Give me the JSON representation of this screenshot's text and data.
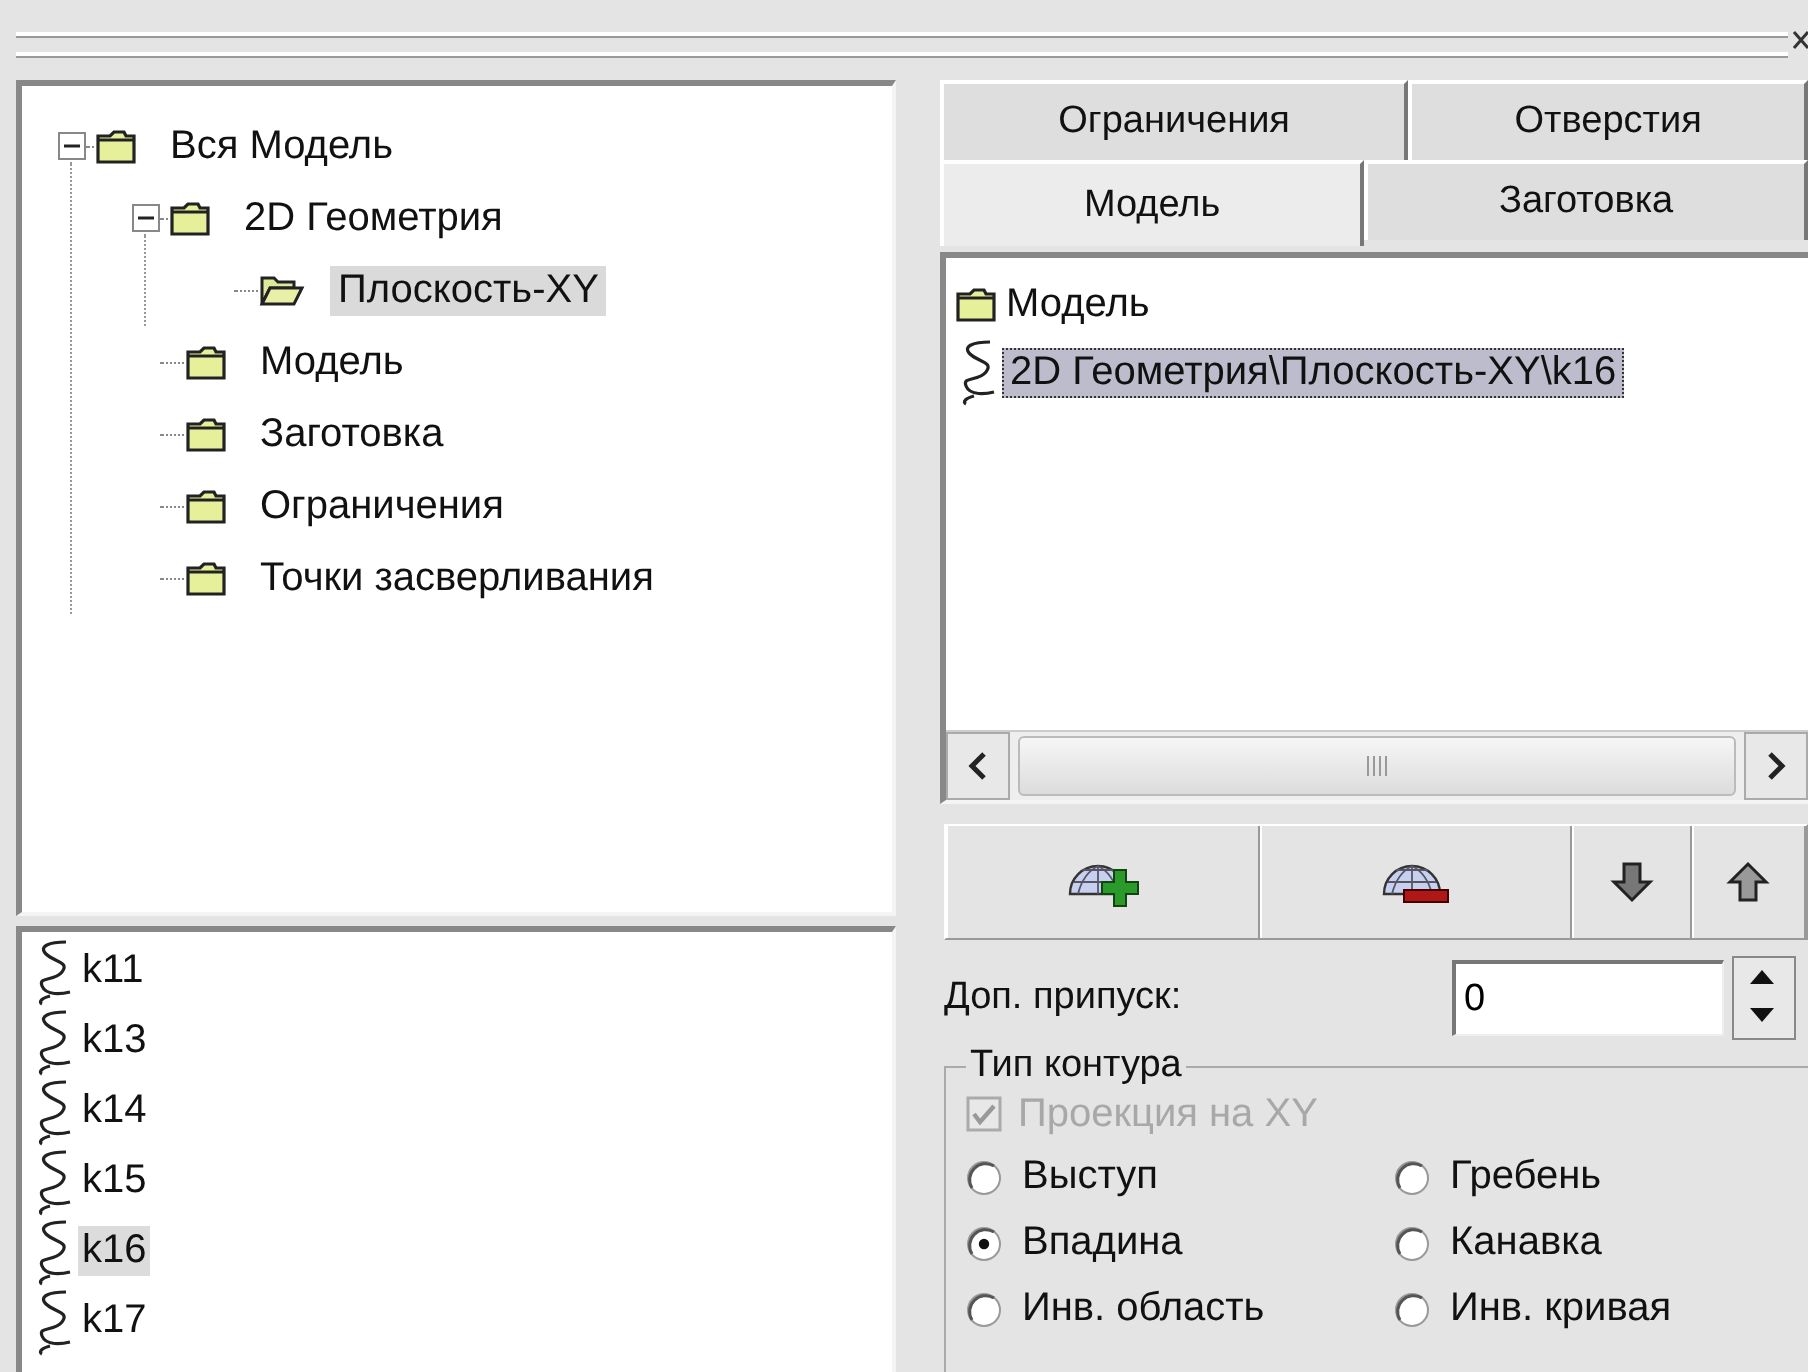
{
  "tree": [
    {
      "label": "Вся Модель",
      "kind": "folder",
      "selected": false,
      "expanded": true,
      "children": [
        {
          "label": "2D Геометрия",
          "kind": "folder",
          "selected": false,
          "expanded": true,
          "children": [
            {
              "label": "Плоскость-XY",
              "kind": "plane",
              "selected": true
            }
          ]
        },
        {
          "label": "Модель",
          "kind": "folder",
          "selected": false
        },
        {
          "label": "Заготовка",
          "kind": "folder",
          "selected": false
        },
        {
          "label": "Ограничения",
          "kind": "folder",
          "selected": false
        },
        {
          "label": "Точки засверливания",
          "kind": "folder",
          "selected": false
        }
      ]
    }
  ],
  "contours": [
    {
      "label": "k11",
      "selected": false
    },
    {
      "label": "k13",
      "selected": false
    },
    {
      "label": "k14",
      "selected": false
    },
    {
      "label": "k15",
      "selected": false
    },
    {
      "label": "k16",
      "selected": true
    },
    {
      "label": "k17",
      "selected": false
    }
  ],
  "tab_rows": [
    {
      "tabs": [
        {
          "label": "Ограничения",
          "selected": false
        },
        {
          "label": "Отверстия",
          "selected": false
        }
      ]
    },
    {
      "tabs": [
        {
          "label": "Модель",
          "selected": true
        },
        {
          "label": "Заготовка",
          "selected": false
        }
      ]
    }
  ],
  "model_list": [
    {
      "label": "Модель",
      "kind": "folder",
      "selected": false
    },
    {
      "label": "2D Геометрия\\Плоскость-XY\\k16",
      "kind": "contour",
      "selected": true
    }
  ],
  "toolbar": [
    {
      "kind": "add"
    },
    {
      "kind": "remove"
    },
    {
      "kind": "down"
    },
    {
      "kind": "up"
    }
  ],
  "allowance": {
    "label": "Доп. припуск:",
    "value": "0"
  },
  "contour_type": {
    "title": "Тип контура",
    "projection": {
      "label": "Проекция на XY",
      "checked": true,
      "disabled": true
    },
    "options": [
      {
        "label": "Выступ",
        "selected": false
      },
      {
        "label": "Гребень",
        "selected": false
      },
      {
        "label": "Впадина",
        "selected": true
      },
      {
        "label": "Канавка",
        "selected": false
      },
      {
        "label": "Инв. область",
        "selected": false
      },
      {
        "label": "Инв. кривая",
        "selected": false
      }
    ]
  }
}
